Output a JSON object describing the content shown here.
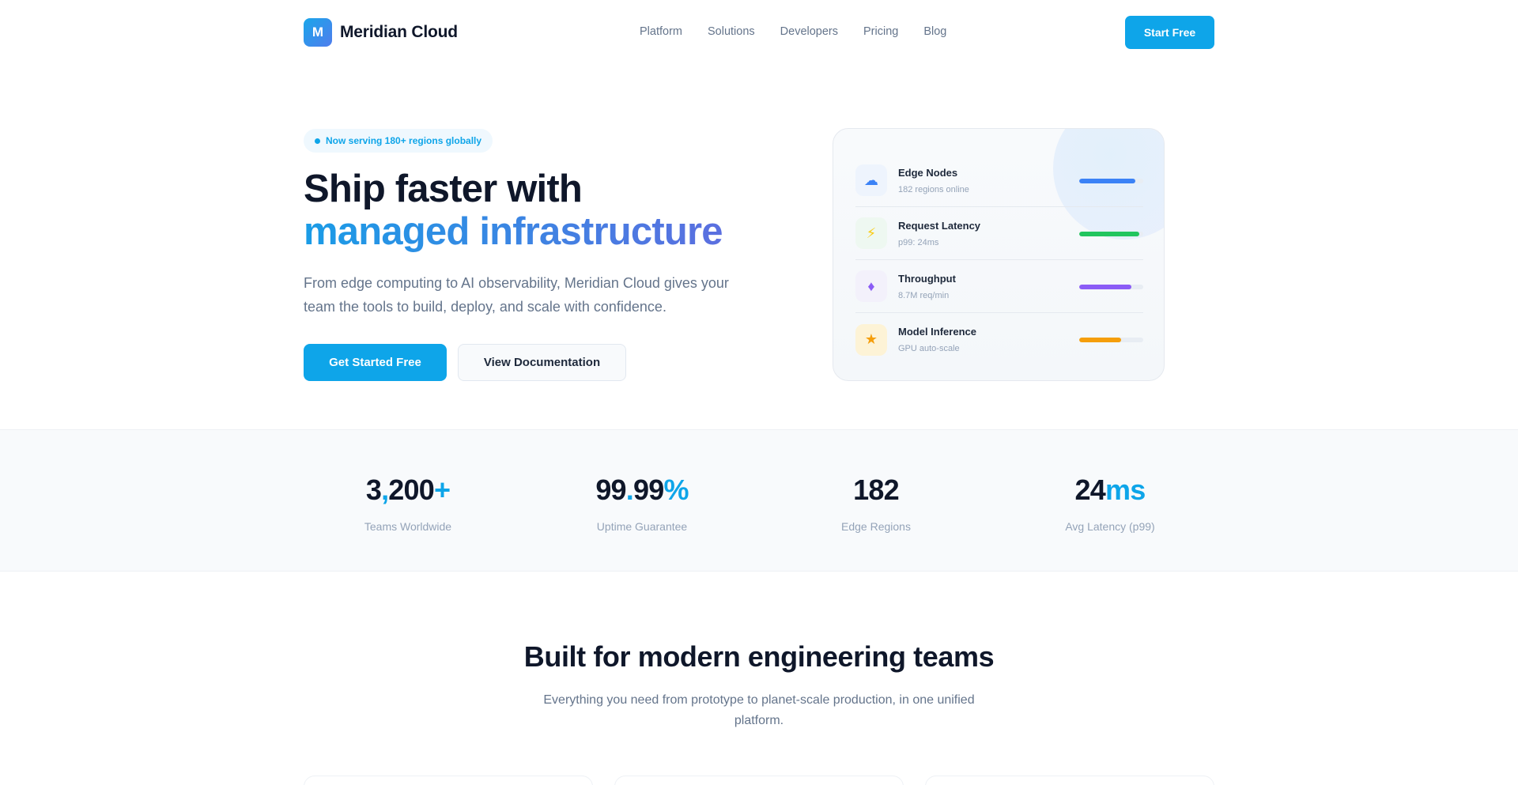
{
  "nav": {
    "logo_letter": "M",
    "brand": "Meridian Cloud",
    "links": [
      "Platform",
      "Solutions",
      "Developers",
      "Pricing",
      "Blog"
    ],
    "cta": "Start Free"
  },
  "hero": {
    "badge": "Now serving 180+ regions globally",
    "title_line1": "Ship faster with",
    "title_line2": "managed infrastructure",
    "description": "From edge computing to AI observability, Meridian Cloud gives your team the tools to build, deploy, and scale with confidence.",
    "primary_button": "Get Started Free",
    "secondary_button": "View Documentation"
  },
  "metrics": [
    {
      "title": "Edge Nodes",
      "subtitle": "182 regions online",
      "icon": "cloud-icon",
      "glyph": "☁",
      "icon_color": "#3b82f6",
      "icon_bg": "#eef4fd",
      "fill": 0.88,
      "bar_color": "#3b82f6"
    },
    {
      "title": "Request Latency",
      "subtitle": "p99: 24ms",
      "icon": "lightning-icon",
      "glyph": "⚡",
      "icon_color": "#facc15",
      "icon_bg": "#eef8f1",
      "fill": 0.94,
      "bar_color": "#22c55e"
    },
    {
      "title": "Throughput",
      "subtitle": "8.7M req/min",
      "icon": "diamond-icon",
      "glyph": "♦",
      "icon_color": "#8b5cf6",
      "icon_bg": "#f3f1fb",
      "fill": 0.82,
      "bar_color": "#8b5cf6"
    },
    {
      "title": "Model Inference",
      "subtitle": "GPU auto-scale",
      "icon": "star-icon",
      "glyph": "★",
      "icon_color": "#f59e0b",
      "icon_bg": "#fdf3d6",
      "fill": 0.66,
      "bar_color": "#f59e0b"
    }
  ],
  "stats": [
    {
      "parts": [
        [
          "3",
          ""
        ],
        [
          ",",
          "acc"
        ],
        [
          "200",
          ""
        ],
        [
          "+",
          "acc"
        ]
      ],
      "value": "3,200+",
      "label": "Teams Worldwide"
    },
    {
      "parts": [
        [
          "99",
          ""
        ],
        [
          ".",
          "acc"
        ],
        [
          "99",
          ""
        ],
        [
          "%",
          "acc"
        ]
      ],
      "value": "99.99%",
      "label": "Uptime Guarantee"
    },
    {
      "parts": [
        [
          "182",
          ""
        ]
      ],
      "value": "182",
      "label": "Edge Regions"
    },
    {
      "parts": [
        [
          "24",
          ""
        ],
        [
          "ms",
          "acc"
        ]
      ],
      "value": "24ms",
      "label": "Avg Latency (p99)"
    }
  ],
  "features": {
    "title": "Built for modern engineering teams",
    "description": "Everything you need from prototype to planet-scale production, in one unified platform."
  },
  "colors": {
    "accent": "#0ea5e9",
    "text": "#0f172a",
    "muted": "#64748b"
  }
}
